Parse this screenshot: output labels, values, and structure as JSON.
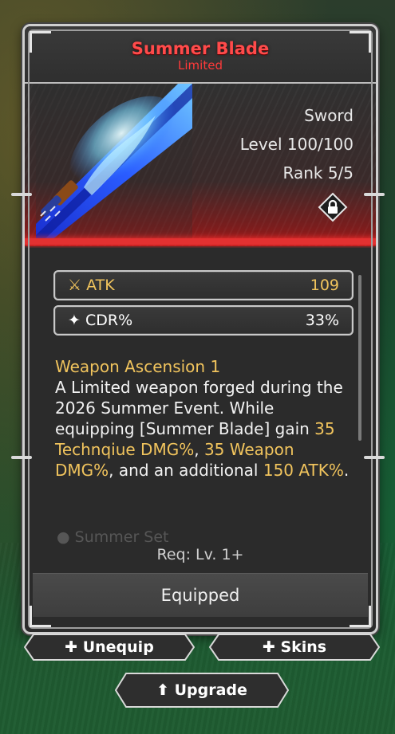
{
  "item": {
    "name": "Summer Blade",
    "rarity": "Limited",
    "type": "Sword",
    "level": "Level 100/100",
    "rank": "Rank 5/5"
  },
  "stats": [
    {
      "icon": "crossed-swords-icon",
      "label": "ATK",
      "value": "109",
      "color": "#f1c45d"
    },
    {
      "icon": "sparkle-icon",
      "label": "CDR%",
      "value": "33%",
      "color": "#ffffff"
    }
  ],
  "description": {
    "heading": "Weapon Ascension 1",
    "p1": "A Limited weapon forged during the 2026 Summer Event. While equipping [Summer Blade] gain ",
    "h1": "35 Technqiue DMG%",
    "p2": ", ",
    "h2": "35 Weapon DMG%",
    "p3": ", and an additional ",
    "h3": "150 ATK%",
    "p4": "."
  },
  "set_preview": "Summer Set",
  "requirement": "Req: Lv. 1+",
  "status_button": "Equipped",
  "buttons": {
    "unequip": "Unequip",
    "skins": "Skins",
    "upgrade": "Upgrade"
  },
  "colors": {
    "title": "#ff4b4b",
    "accent_gold": "#f1c45d",
    "rarity_red": "#e33131"
  }
}
